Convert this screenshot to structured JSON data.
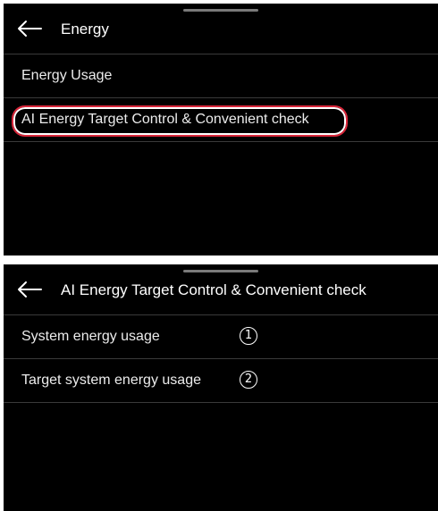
{
  "screen_energy": {
    "header": {
      "title": "Energy"
    },
    "items": [
      {
        "label": "Energy Usage"
      },
      {
        "label": "AI Energy Target Control & Convenient check"
      }
    ]
  },
  "screen_ai": {
    "header": {
      "title": "AI Energy Target Control & Convenient check"
    },
    "items": [
      {
        "label": "System energy usage",
        "callout": "1"
      },
      {
        "label": "Target system energy usage",
        "callout": "2"
      }
    ]
  },
  "icons": {
    "back": "back-arrow-icon"
  },
  "colors": {
    "background": "#000000",
    "text": "#ffffff",
    "divider": "#3a3a3a",
    "highlight": "#d9263a"
  }
}
